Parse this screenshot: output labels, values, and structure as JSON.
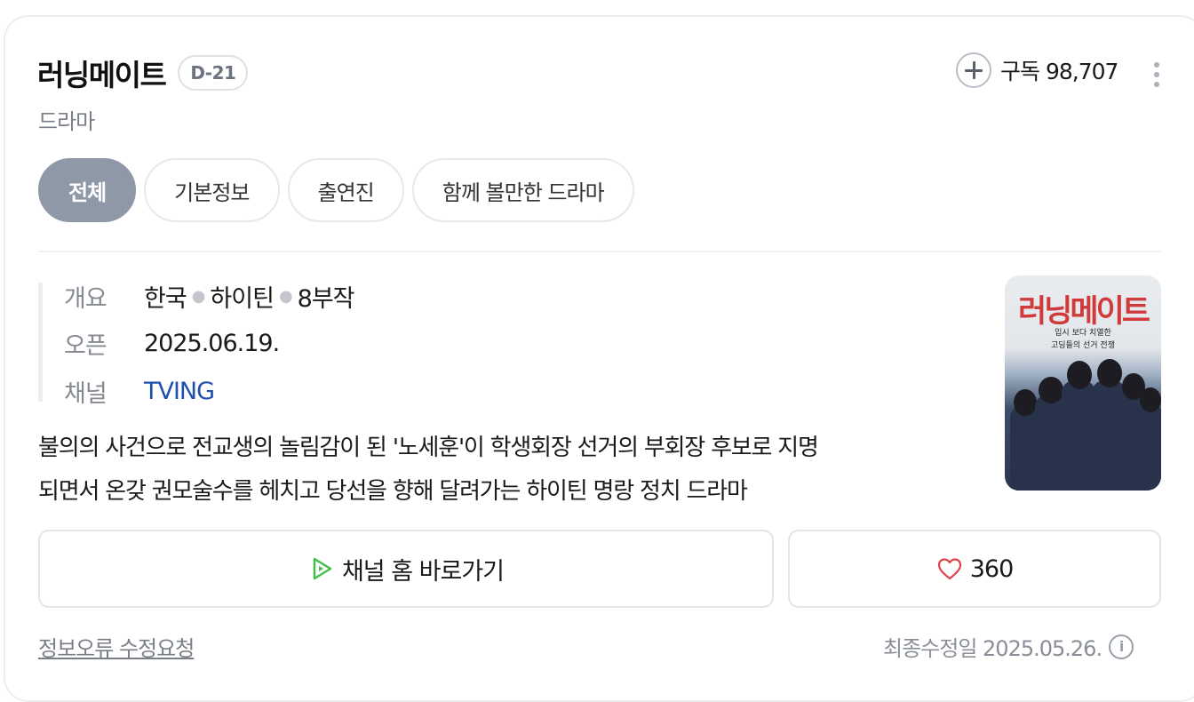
{
  "header": {
    "title": "러닝메이트",
    "dday": "D-21",
    "genre": "드라마",
    "subscribe_label": "구독 98,707"
  },
  "tabs": [
    {
      "label": "전체",
      "active": true
    },
    {
      "label": "기본정보",
      "active": false
    },
    {
      "label": "출연진",
      "active": false
    },
    {
      "label": "함께 볼만한 드라마",
      "active": false
    }
  ],
  "info": {
    "summary_label": "개요",
    "summary_values": [
      "한국",
      "하이틴",
      "8부작"
    ],
    "open_label": "오픈",
    "open_value": "2025.06.19.",
    "channel_label": "채널",
    "channel_value": "TVING"
  },
  "description_lines": [
    "불의의 사건으로 전교생의 놀림감이 된 '노세훈'이 학생회장 선거의 부회장 후보로 지명",
    "되면서 온갖 권모술수를 헤치고 당선을 향해 달려가는 하이틴 명랑 정치 드라마"
  ],
  "poster": {
    "title": "러닝메이트",
    "tagline_1": "입시 보다 치열한",
    "tagline_2": "고딩들의 선거 전쟁"
  },
  "actions": {
    "channel_home_label": "채널 홈 바로가기",
    "like_count": "360"
  },
  "footer": {
    "report_label": "정보오류 수정요청",
    "updated_label": "최종수정일 2025.05.26."
  },
  "colors": {
    "active_tab": "#8f98a6",
    "channel_link": "#1f4fae",
    "play_icon": "#3fbf4a",
    "heart_icon": "#e0434a"
  }
}
